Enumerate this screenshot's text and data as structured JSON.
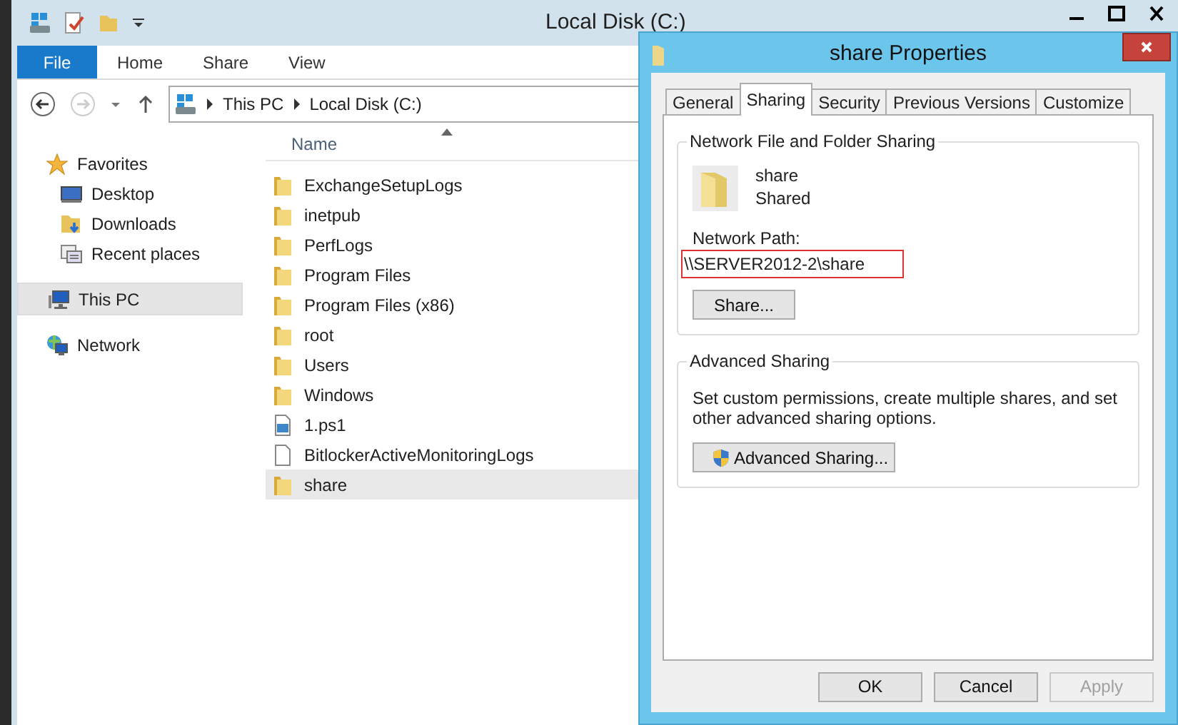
{
  "explorer": {
    "title": "Local Disk (C:)",
    "file_menu": "File",
    "ribbon_tabs": [
      "Home",
      "Share",
      "View"
    ],
    "breadcrumb": [
      "This PC",
      "Local Disk (C:)"
    ],
    "nav": [
      {
        "label": "Favorites",
        "kind": "favorites",
        "selected": false,
        "children": [
          {
            "label": "Desktop",
            "kind": "desktop",
            "selected": false
          },
          {
            "label": "Downloads",
            "kind": "downloads",
            "selected": false
          },
          {
            "label": "Recent places",
            "kind": "recent",
            "selected": false
          }
        ]
      },
      {
        "label": "This PC",
        "kind": "pc",
        "selected": true
      },
      {
        "label": "Network",
        "kind": "network",
        "selected": false
      }
    ],
    "column": "Name",
    "rows": [
      {
        "name": "ExchangeSetupLogs",
        "kind": "folder",
        "selected": false
      },
      {
        "name": "inetpub",
        "kind": "folder",
        "selected": false
      },
      {
        "name": "PerfLogs",
        "kind": "folder",
        "selected": false
      },
      {
        "name": "Program Files",
        "kind": "folder",
        "selected": false
      },
      {
        "name": "Program Files (x86)",
        "kind": "folder",
        "selected": false
      },
      {
        "name": "root",
        "kind": "folder",
        "selected": false
      },
      {
        "name": "Users",
        "kind": "folder",
        "selected": false
      },
      {
        "name": "Windows",
        "kind": "folder",
        "selected": false
      },
      {
        "name": "1.ps1",
        "kind": "script",
        "selected": false
      },
      {
        "name": "BitlockerActiveMonitoringLogs",
        "kind": "file",
        "selected": false
      },
      {
        "name": "share",
        "kind": "folder",
        "selected": true
      }
    ]
  },
  "dialog": {
    "title": "share Properties",
    "tabs": [
      {
        "label": "General",
        "selected": false
      },
      {
        "label": "Sharing",
        "selected": true
      },
      {
        "label": "Security",
        "selected": false
      },
      {
        "label": "Previous Versions",
        "selected": false
      },
      {
        "label": "Customize",
        "selected": false
      }
    ],
    "sharing_group": {
      "title": "Network File and Folder Sharing",
      "name": "share",
      "status": "Shared",
      "path_label": "Network Path:",
      "path": "\\\\SERVER2012-2\\share",
      "button": "Share..."
    },
    "advanced_group": {
      "title": "Advanced Sharing",
      "description": "Set custom permissions, create multiple shares, and set other advanced sharing options.",
      "button": "Advanced Sharing..."
    },
    "buttons": [
      {
        "label": "OK",
        "disabled": false
      },
      {
        "label": "Cancel",
        "disabled": false
      },
      {
        "label": "Apply",
        "disabled": true
      }
    ]
  }
}
